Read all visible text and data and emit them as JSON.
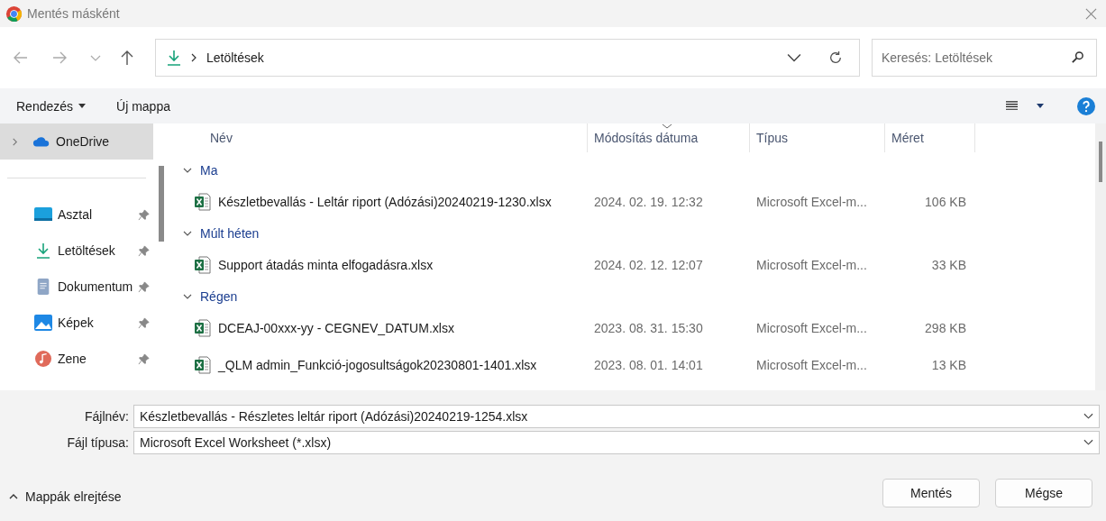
{
  "window": {
    "title": "Mentés másként"
  },
  "nav": {
    "path": "Letöltések",
    "search_placeholder": "Keresés: Letöltések"
  },
  "toolbar": {
    "organize": "Rendezés",
    "new_folder": "Új mappa"
  },
  "sidebar": {
    "sections": [
      {
        "items": [
          {
            "label": "OneDrive",
            "kind": "cloud",
            "selected": true,
            "pinned": false,
            "expanded": false
          }
        ]
      },
      {
        "items": [
          {
            "label": "Asztal",
            "kind": "desktop",
            "selected": false,
            "pinned": true
          },
          {
            "label": "Letöltések",
            "kind": "download",
            "selected": false,
            "pinned": true
          },
          {
            "label": "Dokumentum",
            "kind": "document",
            "selected": false,
            "pinned": true
          },
          {
            "label": "Képek",
            "kind": "pictures",
            "selected": false,
            "pinned": true
          },
          {
            "label": "Zene",
            "kind": "music",
            "selected": false,
            "pinned": true
          }
        ]
      }
    ]
  },
  "table": {
    "columns": [
      "Név",
      "Módosítás dátuma",
      "Típus",
      "Méret"
    ],
    "groups": [
      {
        "label": "Ma",
        "expanded": true,
        "files": [
          {
            "name": "Készletbevallás - Leltár riport (Adózási)20240219-1230.xlsx",
            "date": "2024. 02. 19. 12:32",
            "type": "Microsoft Excel-m...",
            "size": "106 KB"
          }
        ]
      },
      {
        "label": "Múlt héten",
        "expanded": true,
        "files": [
          {
            "name": "Support átadás minta elfogadásra.xlsx",
            "date": "2024. 02. 12. 12:07",
            "type": "Microsoft Excel-m...",
            "size": "33 KB"
          }
        ]
      },
      {
        "label": "Régen",
        "expanded": true,
        "files": [
          {
            "name": "DCEAJ-00xxx-yy - CEGNEV_DATUM.xlsx",
            "date": "2023. 08. 31. 15:30",
            "type": "Microsoft Excel-m...",
            "size": "298 KB"
          },
          {
            "name": "_QLM admin_Funkció-jogosultságok20230801-1401.xlsx",
            "date": "2023. 08. 01. 14:01",
            "type": "Microsoft Excel-m...",
            "size": "13 KB"
          }
        ]
      }
    ]
  },
  "fields": [
    {
      "label": "Fájlnév:",
      "value": "Készletbevallás - Részletes leltár riport (Adózási)20240219-1254.xlsx"
    },
    {
      "label": "Fájl típusa:",
      "value": "Microsoft Excel Worksheet (*.xlsx)"
    }
  ],
  "footer": {
    "toggle": "Mappák elrejtése",
    "buttons": [
      "Mentés",
      "Mégse"
    ]
  }
}
